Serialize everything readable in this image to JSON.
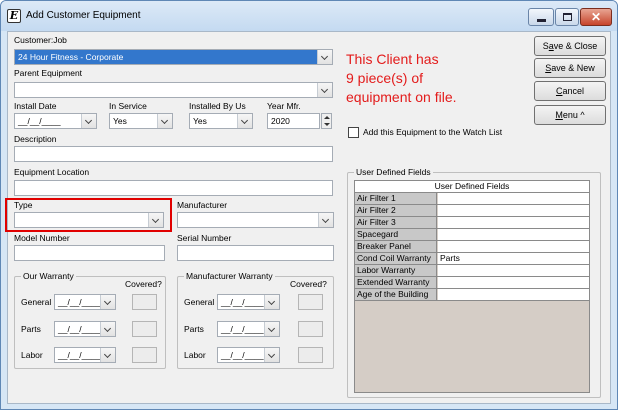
{
  "window": {
    "title": "Add Customer Equipment",
    "icon_letter": "E",
    "controls": {
      "minimize": "minimize-icon",
      "maximize": "maximize-icon",
      "close": "close-icon"
    }
  },
  "colors": {
    "message": "#e31b1b",
    "highlight": "#e10000",
    "selection": "#3377cc"
  },
  "customer_job": {
    "label": "Customer:Job",
    "value": "24 Hour Fitness - Corporate"
  },
  "parent_equipment": {
    "label": "Parent Equipment",
    "value": ""
  },
  "install_date": {
    "label": "Install Date",
    "value": "__/__/____"
  },
  "in_service": {
    "label": "In Service",
    "value": "Yes"
  },
  "installed_by_us": {
    "label": "Installed By Us",
    "value": "Yes"
  },
  "year_mfr": {
    "label": "Year Mfr.",
    "value": "2020"
  },
  "description": {
    "label": "Description",
    "value": ""
  },
  "equipment_location": {
    "label": "Equipment Location",
    "value": ""
  },
  "type": {
    "label": "Type",
    "value": ""
  },
  "manufacturer": {
    "label": "Manufacturer",
    "value": ""
  },
  "model_number": {
    "label": "Model Number",
    "value": ""
  },
  "serial_number": {
    "label": "Serial Number",
    "value": ""
  },
  "message": {
    "line1": "This Client has",
    "line2": "9 piece(s) of",
    "line3": "equipment on file."
  },
  "buttons": {
    "save_close": {
      "pre": "S",
      "ul": "a",
      "post": "ve & Close"
    },
    "save_new": {
      "pre": "",
      "ul": "S",
      "post": "ave & New"
    },
    "cancel": {
      "pre": "",
      "ul": "C",
      "post": "ancel"
    },
    "menu": {
      "pre": "",
      "ul": "M",
      "post": "enu ^"
    }
  },
  "watch_list": {
    "label": "Add this Equipment to the Watch List",
    "checked": false
  },
  "our_warranty": {
    "title": "Our Warranty",
    "covered_label": "Covered?",
    "rows": [
      {
        "label": "General",
        "date": "__/__/____"
      },
      {
        "label": "Parts",
        "date": "__/__/____"
      },
      {
        "label": "Labor",
        "date": "__/__/____"
      }
    ]
  },
  "manufacturer_warranty": {
    "title": "Manufacturer Warranty",
    "covered_label": "Covered?",
    "rows": [
      {
        "label": "General",
        "date": "__/__/____"
      },
      {
        "label": "Parts",
        "date": "__/__/____"
      },
      {
        "label": "Labor",
        "date": "__/__/____"
      }
    ]
  },
  "udf": {
    "group_title": "User Defined Fields",
    "grid_header": "User Defined Fields",
    "rows": [
      {
        "name": "Air Filter 1",
        "value": ""
      },
      {
        "name": "Air Filter 2",
        "value": ""
      },
      {
        "name": "Air Filter 3",
        "value": ""
      },
      {
        "name": "Spacegard",
        "value": ""
      },
      {
        "name": "Breaker Panel",
        "value": ""
      },
      {
        "name": "Cond Coil Warranty",
        "value": "Parts"
      },
      {
        "name": "Labor Warranty",
        "value": ""
      },
      {
        "name": "Extended Warranty",
        "value": ""
      },
      {
        "name": "Age of the Building",
        "value": ""
      }
    ]
  }
}
